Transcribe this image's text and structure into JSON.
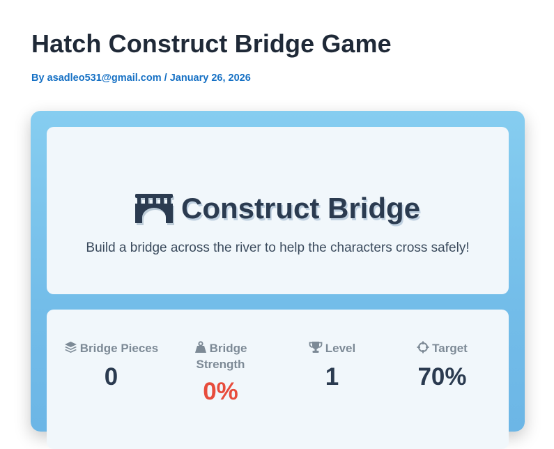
{
  "post": {
    "title": "Hatch Construct Bridge Game",
    "byline_prefix": "By ",
    "author": "asadleo531@gmail.com",
    "separator": " / ",
    "date": "January 26, 2026"
  },
  "game": {
    "title": "Construct Bridge",
    "title_icon": "bridge-icon",
    "subtitle": "Build a bridge across the river to help the characters cross safely!"
  },
  "stats": [
    {
      "icon": "layers-icon",
      "label": "Bridge Pieces",
      "value": "0"
    },
    {
      "icon": "weight-icon",
      "label_line1": "Bridge",
      "label_line2": "Strength",
      "value": "0%"
    },
    {
      "icon": "trophy-icon",
      "label": "Level",
      "value": "1"
    },
    {
      "icon": "crosshairs-icon",
      "label": "Target",
      "value": "70%"
    }
  ],
  "colors": {
    "title": "#1f2937",
    "link": "#1570c4",
    "container": "#7cc4ec",
    "card": "#f1f7fb",
    "heading": "#2b3b50",
    "muted": "#7d8a96",
    "danger": "#e74c3c"
  }
}
